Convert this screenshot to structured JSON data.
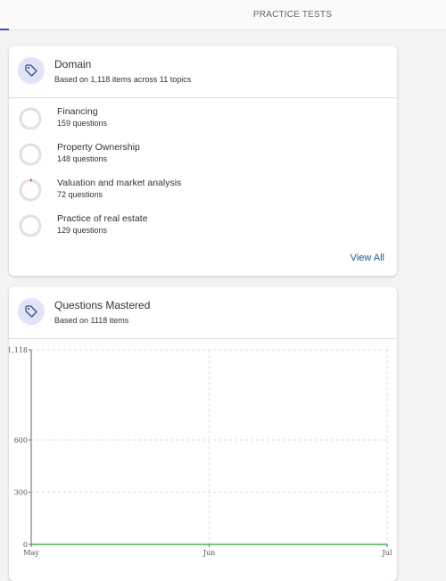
{
  "header": {
    "tab_label": "PRACTICE TESTS"
  },
  "domain_card": {
    "icon": "tag-icon",
    "title": "Domain",
    "subtitle": "Based on 1,118 items across 11 topics",
    "topics": [
      {
        "name": "Financing",
        "count": "159 questions",
        "progress": 0
      },
      {
        "name": "Property Ownership",
        "count": "148 questions",
        "progress": 0
      },
      {
        "name": "Valuation and market analysis",
        "count": "72 questions",
        "progress": 0.02
      },
      {
        "name": "Practice of real estate",
        "count": "129 questions",
        "progress": 0
      }
    ],
    "view_all_label": "View All"
  },
  "mastered_card": {
    "icon": "tag-icon",
    "title": "Questions Mastered",
    "subtitle": "Based on 1118 items"
  },
  "colors": {
    "accent": "#3f51b5",
    "ring_track": "#e0e0e0",
    "ring_progress": "#d32f2f",
    "line": "#4caf50",
    "link": "#1c5d86"
  },
  "chart_data": {
    "type": "line",
    "x": [
      "May",
      "Jun",
      "Jul"
    ],
    "y_ticks": [
      "0",
      "300",
      "600",
      "1,118"
    ],
    "ylim": [
      0,
      1118
    ],
    "series": [
      {
        "values": [
          0,
          0,
          0
        ]
      }
    ],
    "grid": true
  }
}
